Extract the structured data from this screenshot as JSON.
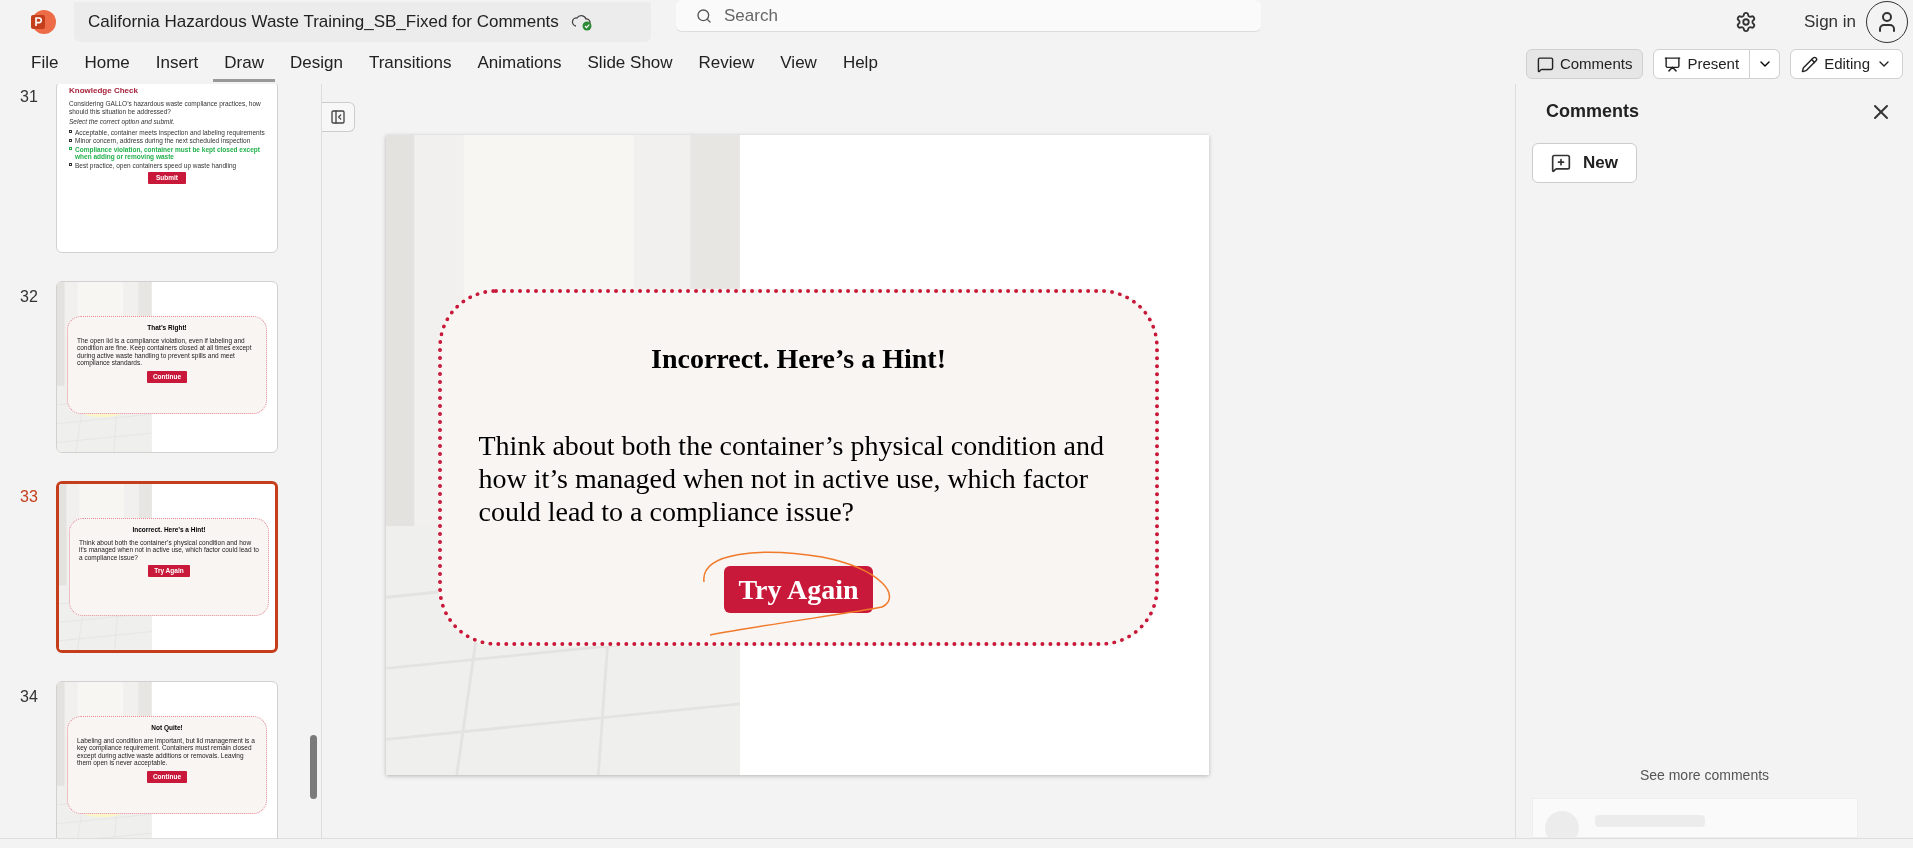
{
  "app": {
    "title": "California Hazardous Waste Training_SB_Fixed for Comments",
    "search_placeholder": "Search",
    "sign_in": "Sign in"
  },
  "ribbon_tabs": [
    {
      "label": "File",
      "selected": false
    },
    {
      "label": "Home",
      "selected": false
    },
    {
      "label": "Insert",
      "selected": false
    },
    {
      "label": "Draw",
      "selected": true
    },
    {
      "label": "Design",
      "selected": false
    },
    {
      "label": "Transitions",
      "selected": false
    },
    {
      "label": "Animations",
      "selected": false
    },
    {
      "label": "Slide Show",
      "selected": false
    },
    {
      "label": "Review",
      "selected": false
    },
    {
      "label": "View",
      "selected": false
    },
    {
      "label": "Help",
      "selected": false
    }
  ],
  "ribbon_buttons": [
    {
      "kind": "comments",
      "label": "Comments",
      "selected": true
    },
    {
      "kind": "present",
      "label": "Present",
      "selected": false
    },
    {
      "kind": "editing",
      "label": "Editing",
      "selected": false
    }
  ],
  "slides": [
    {
      "number": "31",
      "selected": false,
      "kind": "quiz",
      "title": "Knowledge Check",
      "question": "Considering GALLO’s hazardous waste compliance practices, how should this situation be addressed?",
      "instruction": "Select the correct option and submit.",
      "options": [
        {
          "text": "Acceptable, container meets inspection and labeling requirements",
          "correct": false
        },
        {
          "text": "Minor concern, address during the next scheduled inspection",
          "correct": false
        },
        {
          "text": "Compliance violation, container must be kept closed except when adding or removing waste",
          "correct": true
        },
        {
          "text": "Best practice, open containers speed up waste handling",
          "correct": false
        }
      ],
      "button": "Submit"
    },
    {
      "number": "32",
      "selected": false,
      "kind": "feedback",
      "heading": "That’s Right!",
      "body": "The open lid is a compliance violation, even if labeling and condition are fine. Keep containers closed at all times except during active waste handling to prevent spills and meet compliance standards.",
      "button": "Continue"
    },
    {
      "number": "33",
      "selected": true,
      "kind": "feedback",
      "heading": "Incorrect. Here’s a Hint!",
      "body": "Think about both the container’s physical condition and how it’s managed when not in active use, which factor could lead to a compliance issue?",
      "button": "Try Again"
    },
    {
      "number": "34",
      "selected": false,
      "kind": "feedback",
      "heading": "Not Quite!",
      "body": "Labeling and condition are important, but lid management is a key compliance requirement. Containers must remain closed except during active waste additions or removals. Leaving them open is never acceptable.",
      "button": "Continue"
    }
  ],
  "current_slide": {
    "heading": "Incorrect. Here’s a Hint!",
    "body": "Think about both the container’s physical condition and how it’s managed when not in active use, which factor could lead to a compliance issue?",
    "button": "Try Again"
  },
  "comments_panel": {
    "title": "Comments",
    "new_button": "New",
    "see_more": "See more comments"
  }
}
